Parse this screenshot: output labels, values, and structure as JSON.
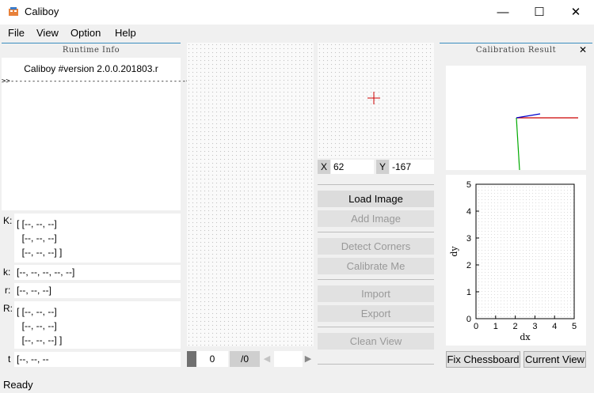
{
  "window": {
    "title": "Caliboy",
    "minimize": "—",
    "maximize": "☐",
    "close": "✕"
  },
  "menu": [
    "File",
    "View",
    "Option",
    "Help"
  ],
  "runtime": {
    "title": "Runtime Info",
    "lines": [
      "Caliboy #version 2.0.0.201803.r",
      ">>-----------------------------------------<<"
    ]
  },
  "matrices": {
    "K": {
      "label": "K:",
      "lines": [
        "[ [--, --, --]",
        "  [--, --, --]",
        "  [--, --, --] ]"
      ]
    },
    "k": {
      "label": "k:",
      "lines": [
        "[--, --, --, --, --]"
      ]
    },
    "r": {
      "label": "r:",
      "lines": [
        "[--, --, --]"
      ]
    },
    "R": {
      "label": "R:",
      "lines": [
        "[ [--, --, --]",
        "  [--, --, --]",
        "  [--, --, --] ]"
      ]
    },
    "t": {
      "label": "t",
      "lines": [
        "[--, --, --"
      ]
    }
  },
  "image_nav": {
    "index": "0",
    "total": "/0",
    "prev": "◀",
    "next": "▶"
  },
  "coords": {
    "x_label": "X",
    "x_value": "62",
    "y_label": "Y",
    "y_value": "-167"
  },
  "buttons": {
    "load_image": "Load Image",
    "add_image": "Add Image",
    "detect_corners": "Detect Corners",
    "calibrate_me": "Calibrate Me",
    "import": "Import",
    "export": "Export",
    "clean_view": "Clean View"
  },
  "calibration": {
    "title": "Calibration Result",
    "close": "✕",
    "fix_chessboard": "Fix Chessboard",
    "current_view": "Current View"
  },
  "axis_colors": {
    "x": "#cc0000",
    "y": "#00aa00",
    "z": "#0000cc",
    "cursor": "#cc0000"
  },
  "chart_data": {
    "type": "scatter",
    "xlabel": "dx",
    "ylabel": "dy",
    "xlim": [
      0,
      5
    ],
    "ylim": [
      0,
      5
    ],
    "xticks": [
      "0",
      "1",
      "2",
      "3",
      "4",
      "5"
    ],
    "yticks": [
      "0",
      "1",
      "2",
      "3",
      "4",
      "5"
    ],
    "grid": true,
    "series": []
  },
  "status": "Ready"
}
